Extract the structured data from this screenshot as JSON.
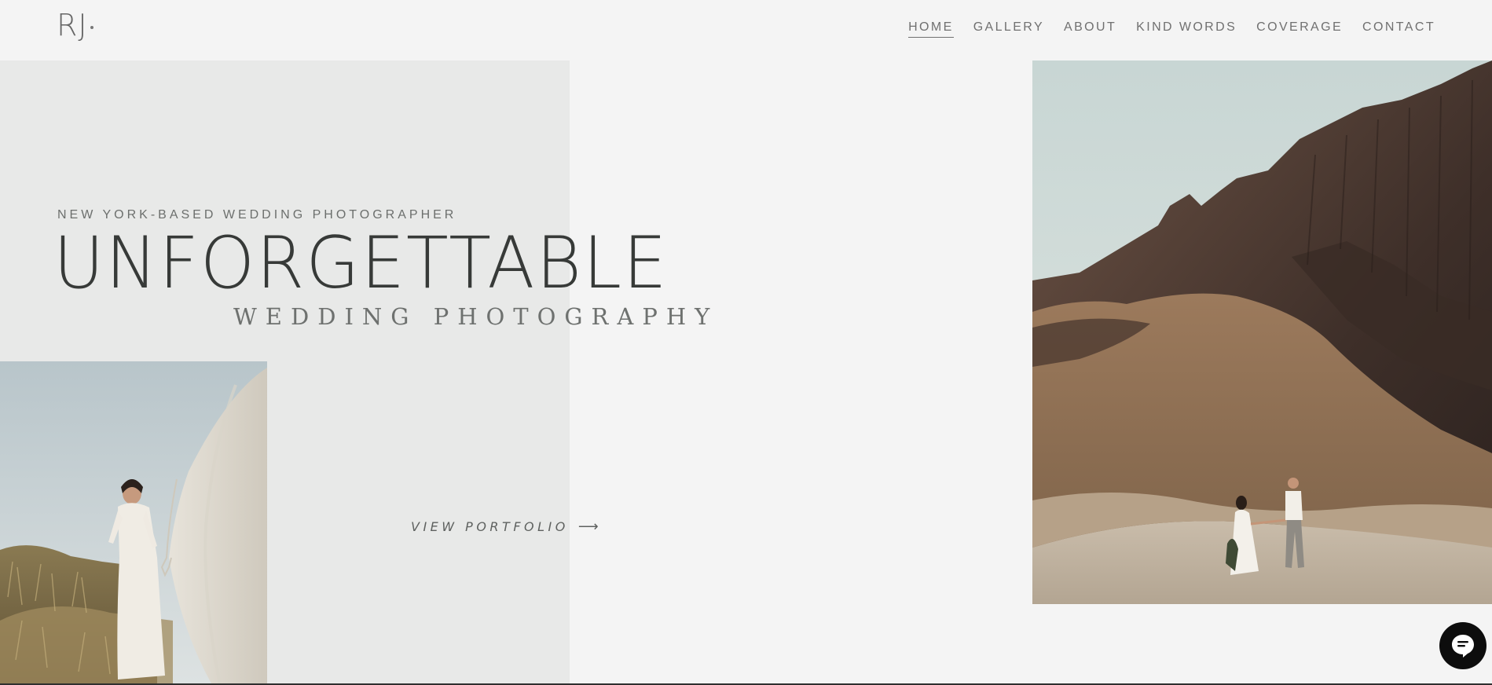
{
  "logo": {
    "text": "RJ"
  },
  "nav": {
    "items": [
      {
        "label": "HOME",
        "active": true
      },
      {
        "label": "GALLERY"
      },
      {
        "label": "ABOUT"
      },
      {
        "label": "KIND WORDS"
      },
      {
        "label": "COVERAGE"
      },
      {
        "label": "CONTACT"
      }
    ]
  },
  "hero": {
    "tagline": "NEW YORK-BASED WEDDING PHOTOGRAPHER",
    "headline": "UNFORGETTABLE",
    "subhead": "WEDDING PHOTOGRAPHY",
    "cta_label": "VIEW PORTFOLIO",
    "cta_icon": "arrow-right-icon"
  },
  "images": {
    "left": "bride-with-veil-photo",
    "right": "couple-in-canyon-photo"
  },
  "chat": {
    "icon": "chat-bubble-icon"
  }
}
